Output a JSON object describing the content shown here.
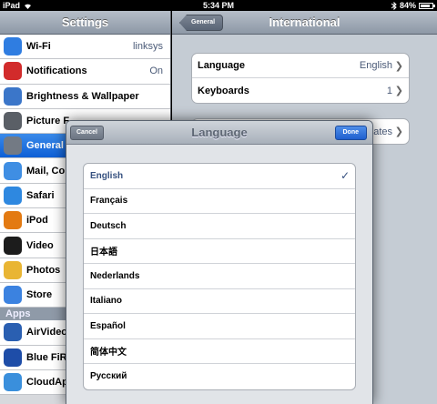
{
  "status_bar": {
    "device": "iPad",
    "time": "5:34 PM",
    "battery": "84%",
    "battery_level": 0.84
  },
  "master": {
    "title": "Settings",
    "items": [
      {
        "label": "Wi-Fi",
        "value": "linksys",
        "icon": "wifi-icon",
        "color": "#2f7de1"
      },
      {
        "label": "Notifications",
        "value": "On",
        "icon": "notifications-icon",
        "color": "#d22b2b"
      },
      {
        "label": "Brightness & Wallpaper",
        "value": "",
        "icon": "brightness-icon",
        "color": "#3b76c9"
      },
      {
        "label": "Picture F",
        "value": "",
        "icon": "picture-frame-icon",
        "color": "#5a5f66"
      },
      {
        "label": "General",
        "value": "",
        "icon": "gear-icon",
        "color": "#737a84",
        "selected": true
      },
      {
        "label": "Mail, Co",
        "value": "",
        "icon": "mail-icon",
        "color": "#3f8ee3"
      },
      {
        "label": "Safari",
        "value": "",
        "icon": "safari-icon",
        "color": "#2e88e0"
      },
      {
        "label": "iPod",
        "value": "",
        "icon": "ipod-icon",
        "color": "#e37a12"
      },
      {
        "label": "Video",
        "value": "",
        "icon": "video-icon",
        "color": "#1c1c1c"
      },
      {
        "label": "Photos",
        "value": "",
        "icon": "photos-icon",
        "color": "#e9b533"
      },
      {
        "label": "Store",
        "value": "",
        "icon": "store-icon",
        "color": "#3b82e0"
      }
    ],
    "section_label": "Apps",
    "apps": [
      {
        "label": "AirVideo",
        "icon": "airvideo-icon",
        "color": "#2a5fb1"
      },
      {
        "label": "Blue FiR",
        "icon": "bluefire-icon",
        "color": "#1e4da8"
      },
      {
        "label": "CloudAp",
        "icon": "cloudapp-icon",
        "color": "#3a8fdc"
      }
    ]
  },
  "detail": {
    "back_label": "General",
    "title": "International",
    "rows": [
      {
        "label": "Language",
        "value": "English"
      },
      {
        "label": "Keyboards",
        "value": "1"
      }
    ],
    "region_value": "States"
  },
  "modal": {
    "title": "Language",
    "cancel_label": "Cancel",
    "done_label": "Done",
    "languages": [
      {
        "label": "English",
        "selected": true
      },
      {
        "label": "Français"
      },
      {
        "label": "Deutsch"
      },
      {
        "label": "日本語"
      },
      {
        "label": "Nederlands"
      },
      {
        "label": "Italiano"
      },
      {
        "label": "Español"
      },
      {
        "label": "简体中文"
      },
      {
        "label": "Русский"
      }
    ],
    "check_mark": "✓"
  }
}
